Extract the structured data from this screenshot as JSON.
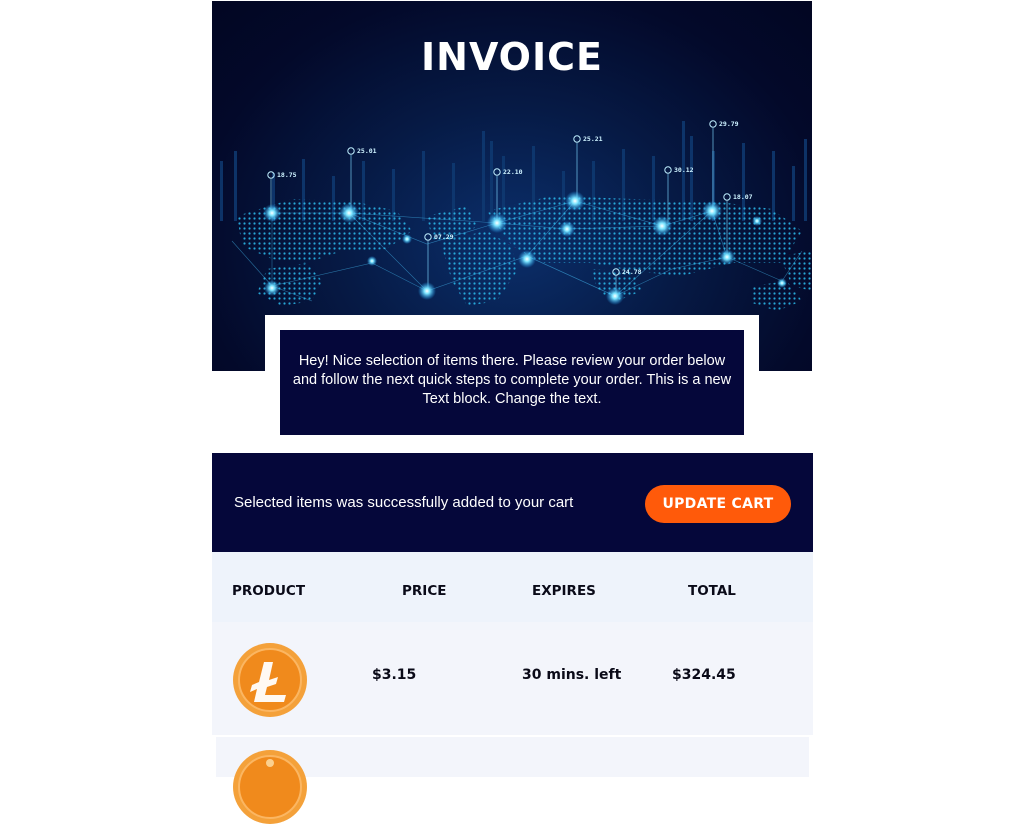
{
  "hero": {
    "title": "INVOICE",
    "map_labels": [
      "18.75",
      "25.01",
      "22.10",
      "25.21",
      "30.12",
      "29.79",
      "18.07",
      "07.29",
      "24.78"
    ]
  },
  "intro": {
    "text": "Hey! Nice selection of items there. Please review your order below and follow the next quick steps to complete your order. This is a new Text block. Change the text."
  },
  "cart": {
    "message": "Selected items was successfully added to your cart",
    "update_label": "UPDATE CART"
  },
  "table": {
    "headers": [
      "PRODUCT",
      "PRICE",
      "EXPIRES",
      "TOTAL"
    ],
    "rows": [
      {
        "icon": "litecoin-icon",
        "price": "$3.15",
        "expires": "30 mins. left",
        "total": "$324.45"
      }
    ]
  },
  "colors": {
    "navy": "#05073a",
    "accent": "#ff5a0a",
    "table_header_bg": "#eef3fb",
    "row_bg": "#f3f5fb",
    "coin": "#f08a1c"
  }
}
